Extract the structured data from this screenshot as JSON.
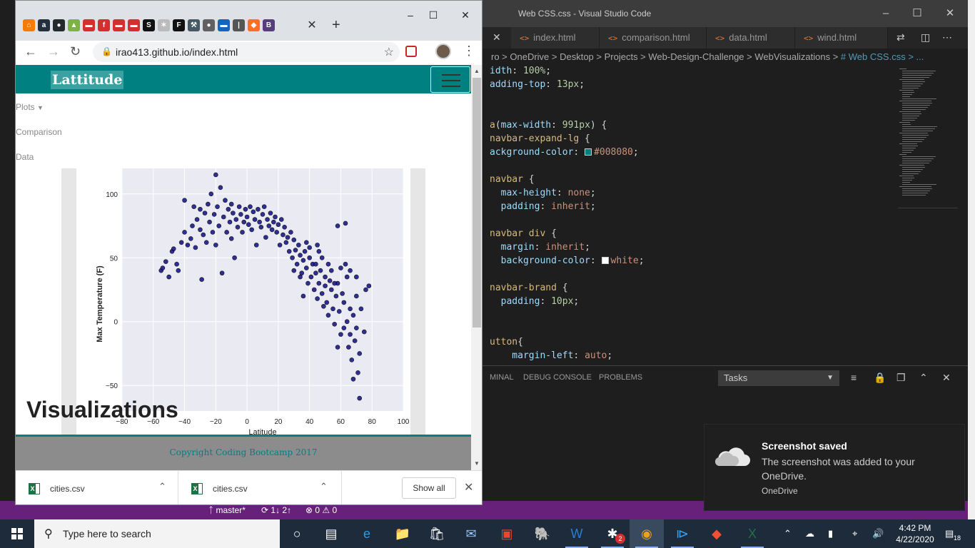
{
  "vscode": {
    "title": "Web CSS.css - Visual Studio Code",
    "tabs": [
      "index.html",
      "comparison.html",
      "data.html",
      "wind.html"
    ],
    "breadcrumb": "ro > OneDrive > Desktop > Projects > Web-Design-Challenge > WebVisualizations > ",
    "breadcrumb_file": "# Web CSS.css > ...",
    "code_lines": [
      {
        "tokens": [
          [
            "prop",
            "idth"
          ],
          [
            "plain",
            ": "
          ],
          [
            "num",
            "100%"
          ],
          [
            "plain",
            ";"
          ]
        ]
      },
      {
        "tokens": [
          [
            "prop",
            "adding-top"
          ],
          [
            "plain",
            ": "
          ],
          [
            "num",
            "13px"
          ],
          [
            "plain",
            ";"
          ]
        ]
      },
      {
        "tokens": [
          [
            "plain",
            ""
          ]
        ]
      },
      {
        "tokens": [
          [
            "plain",
            ""
          ]
        ]
      },
      {
        "tokens": [
          [
            "sel",
            "a"
          ],
          [
            "plain",
            "("
          ],
          [
            "prop",
            "max-width"
          ],
          [
            "plain",
            ": "
          ],
          [
            "num",
            "991px"
          ],
          [
            "plain",
            ") {"
          ]
        ]
      },
      {
        "tokens": [
          [
            "sel",
            "navbar-expand-lg"
          ],
          [
            "plain",
            " {"
          ]
        ]
      },
      {
        "tokens": [
          [
            "prop",
            "ackground-color"
          ],
          [
            "plain",
            ": "
          ],
          [
            "swatch",
            "#008080"
          ],
          [
            "val",
            "#008080"
          ],
          [
            "plain",
            ";"
          ]
        ]
      },
      {
        "tokens": [
          [
            "plain",
            ""
          ]
        ]
      },
      {
        "tokens": [
          [
            "sel",
            "navbar"
          ],
          [
            "plain",
            " {"
          ]
        ]
      },
      {
        "tokens": [
          [
            "prop",
            "  max-height"
          ],
          [
            "plain",
            ": "
          ],
          [
            "val",
            "none"
          ],
          [
            "plain",
            ";"
          ]
        ]
      },
      {
        "tokens": [
          [
            "prop",
            "  padding"
          ],
          [
            "plain",
            ": "
          ],
          [
            "val",
            "inherit"
          ],
          [
            "plain",
            ";"
          ]
        ]
      },
      {
        "tokens": [
          [
            "plain",
            ""
          ]
        ]
      },
      {
        "tokens": [
          [
            "sel",
            "navbar div"
          ],
          [
            "plain",
            " {"
          ]
        ]
      },
      {
        "tokens": [
          [
            "prop",
            "  margin"
          ],
          [
            "plain",
            ": "
          ],
          [
            "val",
            "inherit"
          ],
          [
            "plain",
            ";"
          ]
        ]
      },
      {
        "tokens": [
          [
            "prop",
            "  background-color"
          ],
          [
            "plain",
            ": "
          ],
          [
            "swatch",
            "#ffffff"
          ],
          [
            "val",
            "white"
          ],
          [
            "plain",
            ";"
          ]
        ]
      },
      {
        "tokens": [
          [
            "plain",
            ""
          ]
        ]
      },
      {
        "tokens": [
          [
            "sel",
            "navbar-brand"
          ],
          [
            "plain",
            " {"
          ]
        ]
      },
      {
        "tokens": [
          [
            "prop",
            "  padding"
          ],
          [
            "plain",
            ": "
          ],
          [
            "num",
            "10px"
          ],
          [
            "plain",
            ";"
          ]
        ]
      },
      {
        "tokens": [
          [
            "plain",
            ""
          ]
        ]
      },
      {
        "tokens": [
          [
            "plain",
            ""
          ]
        ]
      },
      {
        "tokens": [
          [
            "sel",
            "utton"
          ],
          [
            "plain",
            "{"
          ]
        ]
      },
      {
        "tokens": [
          [
            "prop",
            "    margin-left"
          ],
          [
            "plain",
            ": "
          ],
          [
            "val",
            "auto"
          ],
          [
            "plain",
            ";"
          ]
        ]
      }
    ],
    "panel_tabs": [
      "MINAL",
      "DEBUG CONSOLE",
      "PROBLEMS"
    ],
    "panel_select": "Tasks",
    "status": {
      "branch": "master*",
      "sync": "1↓ 2↑",
      "problems": "⊗ 0 ⚠ 0"
    }
  },
  "chrome": {
    "tab_favicons": [
      {
        "label": "⌂",
        "color": "#f57c00"
      },
      {
        "label": "a",
        "color": "#232f3e"
      },
      {
        "label": "●",
        "color": "#24292e"
      },
      {
        "label": "▲",
        "color": "#7cb342"
      },
      {
        "label": "▬",
        "color": "#d32f2f"
      },
      {
        "label": "f",
        "color": "#d32f2f"
      },
      {
        "label": "▬",
        "color": "#d32f2f"
      },
      {
        "label": "▬",
        "color": "#d32f2f"
      },
      {
        "label": "S",
        "color": "#111"
      },
      {
        "label": "✶",
        "color": "#bbb"
      },
      {
        "label": "F",
        "color": "#111"
      },
      {
        "label": "⚒",
        "color": "#455a64"
      },
      {
        "label": "●",
        "color": "#616161"
      },
      {
        "label": "▬",
        "color": "#1565c0"
      },
      {
        "label": "|",
        "color": "#555"
      },
      {
        "label": "◆",
        "color": "#fc6d26"
      },
      {
        "label": "B",
        "color": "#563d7c"
      }
    ],
    "url": "irao413.github.io/index.html",
    "page": {
      "brand": "Lattitude",
      "nav_links": [
        "Plots",
        "Comparison",
        "Data"
      ],
      "heading": "Visualizations",
      "footer": "Copyright Coding Bootcamp 2017"
    },
    "downloads": [
      {
        "name": "cities.csv"
      },
      {
        "name": "cities.csv"
      }
    ],
    "show_all": "Show all"
  },
  "chart_data": {
    "type": "scatter",
    "title": "",
    "xlabel": "Latitude",
    "ylabel": "Max Temperature (F)",
    "xlim": [
      -80,
      100
    ],
    "ylim": [
      -70,
      120
    ],
    "x_ticks": [
      "−80",
      "−60",
      "−40",
      "−20",
      "0",
      "20",
      "40",
      "60",
      "80",
      "100"
    ],
    "y_ticks": [
      "−50",
      "0",
      "50",
      "100"
    ],
    "grid": true,
    "point_color": "#1a1a8c",
    "series": [
      {
        "points": [
          [
            -55,
            40
          ],
          [
            -54,
            42
          ],
          [
            -52,
            47
          ],
          [
            -50,
            35
          ],
          [
            -48,
            55
          ],
          [
            -47,
            57
          ],
          [
            -45,
            45
          ],
          [
            -44,
            40
          ],
          [
            -42,
            62
          ],
          [
            -40,
            70
          ],
          [
            -40,
            95
          ],
          [
            -38,
            60
          ],
          [
            -36,
            65
          ],
          [
            -35,
            75
          ],
          [
            -34,
            90
          ],
          [
            -33,
            58
          ],
          [
            -32,
            80
          ],
          [
            -30,
            72
          ],
          [
            -30,
            88
          ],
          [
            -29,
            33
          ],
          [
            -28,
            68
          ],
          [
            -27,
            85
          ],
          [
            -26,
            62
          ],
          [
            -25,
            92
          ],
          [
            -24,
            78
          ],
          [
            -23,
            100
          ],
          [
            -22,
            70
          ],
          [
            -21,
            84
          ],
          [
            -20,
            115
          ],
          [
            -20,
            60
          ],
          [
            -19,
            90
          ],
          [
            -18,
            75
          ],
          [
            -17,
            105
          ],
          [
            -16,
            38
          ],
          [
            -15,
            82
          ],
          [
            -14,
            95
          ],
          [
            -13,
            70
          ],
          [
            -12,
            88
          ],
          [
            -11,
            78
          ],
          [
            -10,
            65
          ],
          [
            -10,
            92
          ],
          [
            -9,
            85
          ],
          [
            -8,
            50
          ],
          [
            -7,
            80
          ],
          [
            -6,
            74
          ],
          [
            -5,
            90
          ],
          [
            -4,
            84
          ],
          [
            -3,
            70
          ],
          [
            -2,
            78
          ],
          [
            -1,
            88
          ],
          [
            0,
            82
          ],
          [
            1,
            76
          ],
          [
            2,
            90
          ],
          [
            3,
            72
          ],
          [
            4,
            86
          ],
          [
            5,
            80
          ],
          [
            6,
            60
          ],
          [
            7,
            88
          ],
          [
            8,
            78
          ],
          [
            9,
            74
          ],
          [
            10,
            84
          ],
          [
            11,
            90
          ],
          [
            12,
            66
          ],
          [
            13,
            80
          ],
          [
            14,
            75
          ],
          [
            15,
            85
          ],
          [
            16,
            72
          ],
          [
            17,
            78
          ],
          [
            18,
            82
          ],
          [
            19,
            70
          ],
          [
            20,
            76
          ],
          [
            21,
            60
          ],
          [
            22,
            80
          ],
          [
            23,
            68
          ],
          [
            24,
            74
          ],
          [
            25,
            62
          ],
          [
            26,
            66
          ],
          [
            27,
            55
          ],
          [
            28,
            70
          ],
          [
            29,
            50
          ],
          [
            30,
            64
          ],
          [
            30,
            40
          ],
          [
            31,
            56
          ],
          [
            32,
            45
          ],
          [
            33,
            60
          ],
          [
            34,
            52
          ],
          [
            35,
            38
          ],
          [
            36,
            48
          ],
          [
            36,
            20
          ],
          [
            37,
            55
          ],
          [
            38,
            42
          ],
          [
            39,
            30
          ],
          [
            40,
            50
          ],
          [
            40,
            58
          ],
          [
            41,
            35
          ],
          [
            42,
            45
          ],
          [
            43,
            25
          ],
          [
            44,
            38
          ],
          [
            45,
            18
          ],
          [
            45,
            60
          ],
          [
            46,
            30
          ],
          [
            47,
            40
          ],
          [
            48,
            22
          ],
          [
            49,
            12
          ],
          [
            50,
            35
          ],
          [
            50,
            28
          ],
          [
            51,
            15
          ],
          [
            52,
            5
          ],
          [
            53,
            32
          ],
          [
            54,
            25
          ],
          [
            55,
            10
          ],
          [
            56,
            -2
          ],
          [
            57,
            20
          ],
          [
            58,
            30
          ],
          [
            58,
            75
          ],
          [
            59,
            8
          ],
          [
            60,
            -10
          ],
          [
            61,
            22
          ],
          [
            62,
            15
          ],
          [
            63,
            45
          ],
          [
            63,
            77
          ],
          [
            64,
            0
          ],
          [
            65,
            -20
          ],
          [
            66,
            10
          ],
          [
            66,
            40
          ],
          [
            67,
            -30
          ],
          [
            68,
            5
          ],
          [
            68,
            -45
          ],
          [
            69,
            -15
          ],
          [
            70,
            20
          ],
          [
            70,
            -5
          ],
          [
            71,
            -40
          ],
          [
            72,
            -25
          ],
          [
            72,
            -60
          ],
          [
            73,
            10
          ],
          [
            75,
            -8
          ],
          [
            76,
            25
          ],
          [
            78,
            28
          ],
          [
            34,
            35
          ],
          [
            38,
            62
          ],
          [
            44,
            45
          ],
          [
            48,
            50
          ],
          [
            52,
            45
          ],
          [
            56,
            30
          ],
          [
            60,
            42
          ],
          [
            64,
            35
          ],
          [
            70,
            35
          ],
          [
            66,
            -10
          ],
          [
            62,
            -5
          ],
          [
            58,
            -20
          ],
          [
            54,
            40
          ],
          [
            46,
            55
          ]
        ]
      }
    ]
  },
  "toast": {
    "title": "Screenshot saved",
    "body": "The screenshot was added to your OneDrive.",
    "source": "OneDrive"
  },
  "taskbar": {
    "search_placeholder": "Type here to search",
    "time": "4:42 PM",
    "date": "4/22/2020",
    "notification_count": "18",
    "badge_count": "2"
  }
}
